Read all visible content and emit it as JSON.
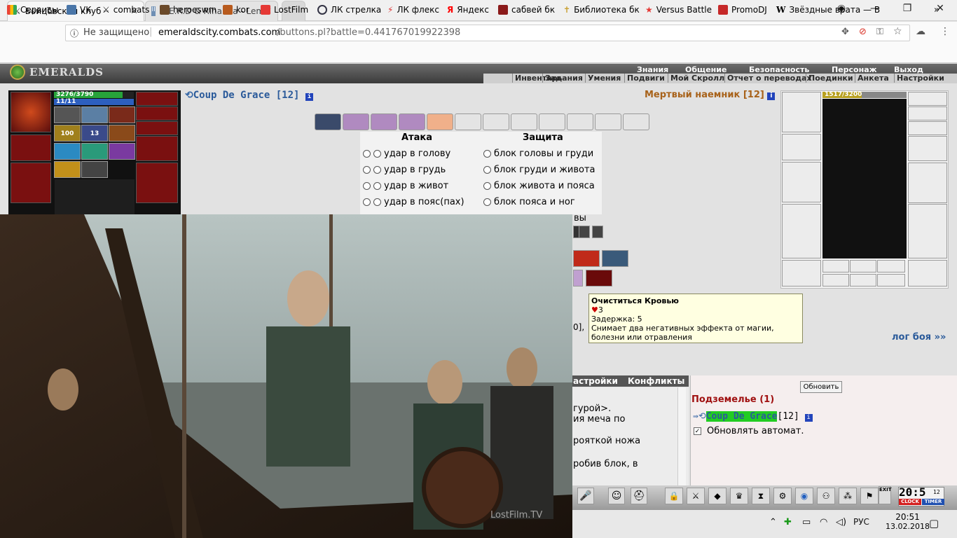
{
  "browser": {
    "tabs": [
      {
        "title": "Бойцовский клуб",
        "active": true
      },
      {
        "title": "N.E.R.D & Rihanna - Lem",
        "active": false
      }
    ],
    "tab_close": "✕",
    "address": {
      "security": "Не защищено",
      "url_host": "emeraldscity.combats.com",
      "url_path": "/buttons.pl?battle=0.441767019922398"
    },
    "bookmarks": [
      "Сервисы",
      "VK",
      "combats",
      "heroeswm",
      "kor",
      "LostFilm",
      "ЛК стрелка",
      "ЛК флекс",
      "Яндекс",
      "сабвей бк",
      "Библиотека бк",
      "Versus Battle",
      "PromoDJ",
      "Звёздные врата — В"
    ],
    "more_bookmarks": "»",
    "accent": "#d93025"
  },
  "game": {
    "logo": "EMERALDS",
    "menu_top": [
      "Знания",
      "Общение",
      "Безопасность",
      "Персонаж",
      "Выход"
    ],
    "menu_sub": [
      "Инвентарь",
      "Задания",
      "Умения",
      "Подвиги",
      "Мой Скролл",
      "Отчет о переводах",
      "Поединки",
      "Анкета",
      "Настройки"
    ],
    "player": {
      "hp": "3276/3790",
      "mana": "11/11",
      "name": "Coup De Grace",
      "level": "[12]",
      "hp_fraction": 0.86,
      "info": "i",
      "badge1": "100",
      "badge2": "13"
    },
    "enemy": {
      "name": "Мертвый наемник",
      "level": "[12]",
      "hp": "1517/3200",
      "hp_fraction": 0.47
    },
    "attack_header": "Атака",
    "defense_header": "Защита",
    "attacks": [
      "удар в голову",
      "удар в грудь",
      "удар в живот",
      "удар в пояс(пах)"
    ],
    "defenses": [
      "блок головы и груди",
      "блок груди и живота",
      "блок живота и пояса",
      "блок пояса и ног"
    ],
    "partial_defense": "вы",
    "partial_log": "0],",
    "tooltip": {
      "title": "Очиститься Кровью",
      "cost": "3",
      "delay": "Задержка: 5",
      "desc": "Снимает два негативных эффекта от магии, болезни или отравления"
    },
    "battle_log_link": "лог боя »»",
    "chat_tabs": [
      "астройки",
      "Конфликты"
    ],
    "chat_lines": [
      "гурой>.",
      "ия меча по",
      "",
      "рояткой ножа",
      "",
      "робив блок, в"
    ],
    "refresh_button": "Обновить",
    "location": "Подземелье (1)",
    "online_name": "Coup De Grace",
    "online_level": "[12]",
    "auto_refresh": "Обновлять автомат.",
    "clock_time": "20:5",
    "clock_sec": "12",
    "clock_label": "CLOCK",
    "timer_label": "TIMER",
    "exit_label": "EXIT"
  },
  "overlay": {
    "watermark": "LostFilm.TV"
  },
  "taskbar": {
    "lang": "РУС",
    "time": "20:51",
    "date": "13.02.2018"
  }
}
